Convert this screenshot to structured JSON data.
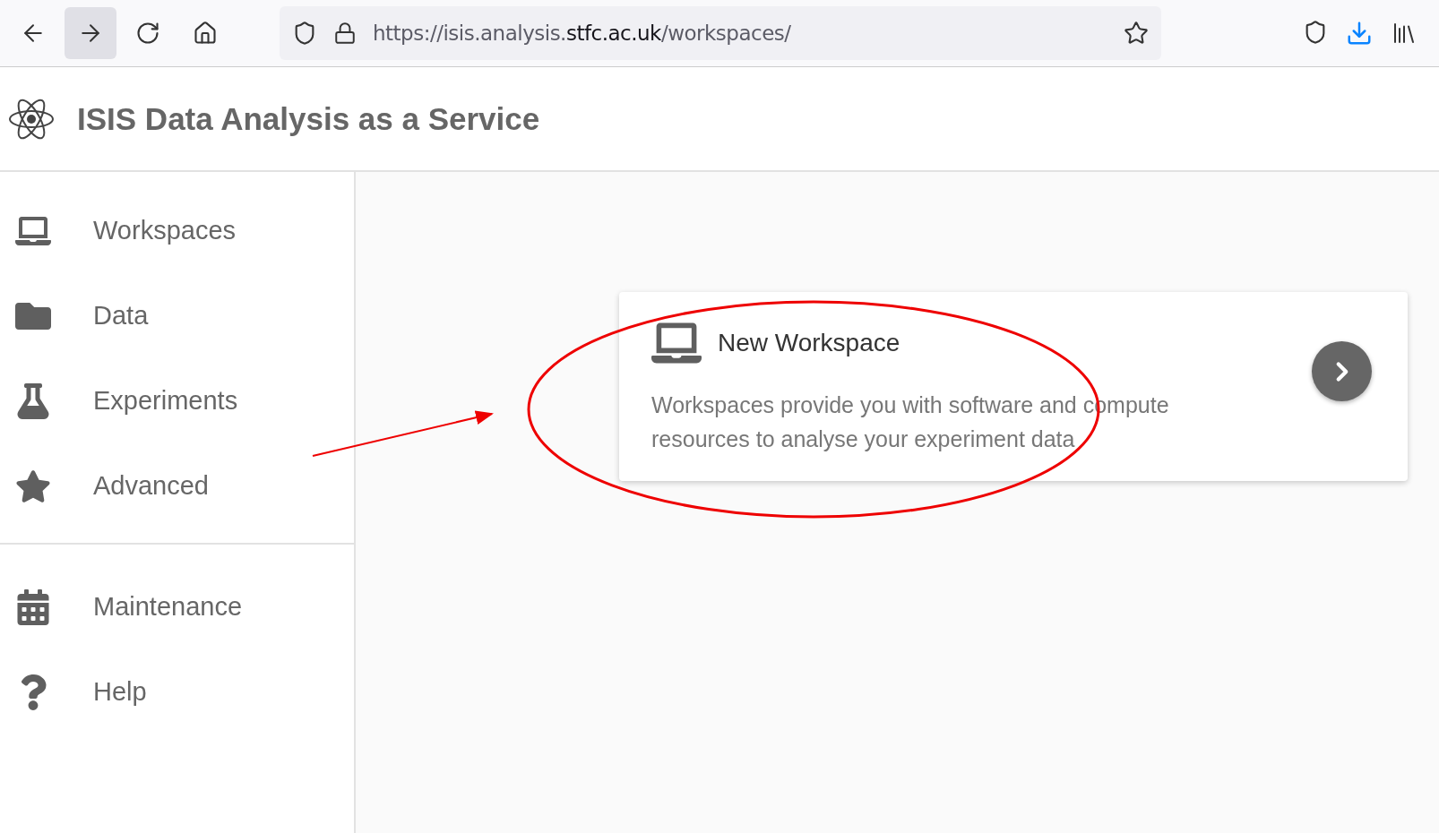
{
  "browser": {
    "url": "https://isis.analysis.**stfc.ac.uk**/workspaces/"
  },
  "header": {
    "title": "ISIS Data Analysis as a Service"
  },
  "sidebar": {
    "groups": [
      [
        {
          "label": "Workspaces"
        },
        {
          "label": "Data"
        },
        {
          "label": "Experiments"
        },
        {
          "label": "Advanced"
        }
      ],
      [
        {
          "label": "Maintenance"
        },
        {
          "label": "Help"
        }
      ]
    ]
  },
  "card": {
    "title": "New Workspace",
    "description": "Workspaces provide you with software and compute resources to analyse your experiment data"
  }
}
